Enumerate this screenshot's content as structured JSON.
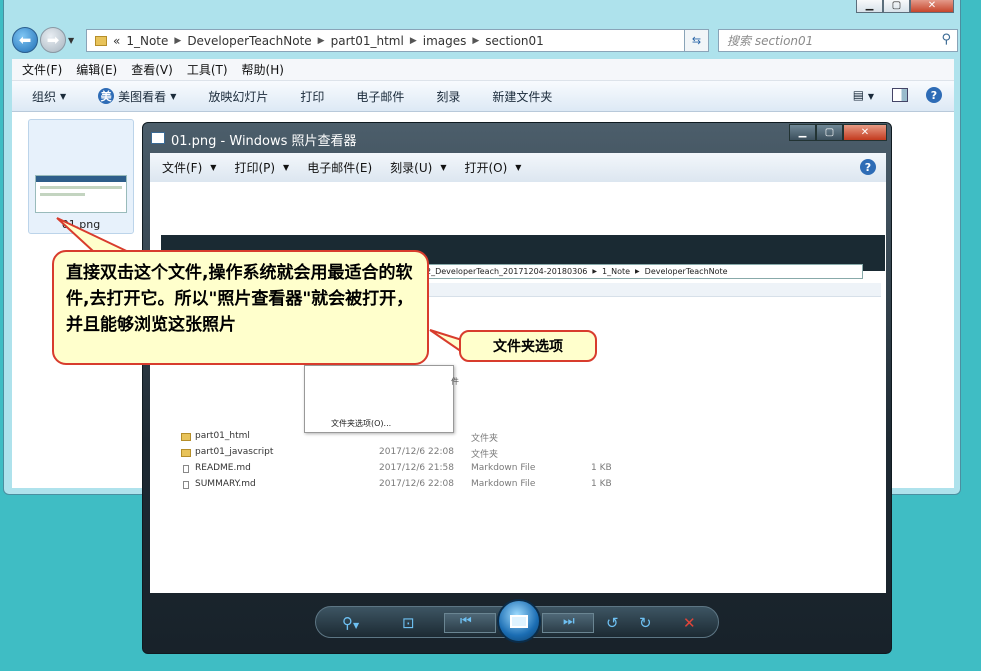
{
  "explorer": {
    "breadcrumb": [
      "1_Note",
      "DeveloperTeachNote",
      "part01_html",
      "images",
      "section01"
    ],
    "breadcrumb_prefix": "«",
    "search_placeholder": "搜索 section01",
    "menu": [
      "文件(F)",
      "编辑(E)",
      "查看(V)",
      "工具(T)",
      "帮助(H)"
    ],
    "toolbar": [
      "组织",
      "美图看看",
      "放映幻灯片",
      "打印",
      "电子邮件",
      "刻录",
      "新建文件夹"
    ],
    "file": {
      "name": "01.png"
    }
  },
  "viewer": {
    "title": "01.png - Windows 照片查看器",
    "menu": [
      "文件(F)",
      "打印(P)",
      "电子邮件(E)",
      "刻录(U)",
      "打开(O)"
    ],
    "screenshot": {
      "address": [
        "2_DeveloperTeach_20171204-20180306",
        "1_Note",
        "DeveloperTeachNote"
      ],
      "menu_partial": "件",
      "menu_item": "文件夹选项(O)...",
      "rows": [
        {
          "name": "part01_html",
          "date": "",
          "type": "文件夹",
          "size": ""
        },
        {
          "name": "part01_javascript",
          "date": "2017/12/6 22:08",
          "type": "文件夹",
          "size": ""
        },
        {
          "name": "README.md",
          "date": "2017/12/6 21:58",
          "type": "Markdown File",
          "size": "1 KB"
        },
        {
          "name": "SUMMARY.md",
          "date": "2017/12/6 22:08",
          "type": "Markdown File",
          "size": "1 KB"
        }
      ]
    }
  },
  "callouts": {
    "main": "直接双击这个文件,操作系统就会用最适合的软件,去打开它。所以\"照片查看器\"就会被打开，并且能够浏览这张照片",
    "secondary": "文件夹选项"
  },
  "colors": {
    "accent_red": "#d83c2d",
    "callout_bg": "#ffffcc",
    "desktop": "#3fbdc4"
  }
}
